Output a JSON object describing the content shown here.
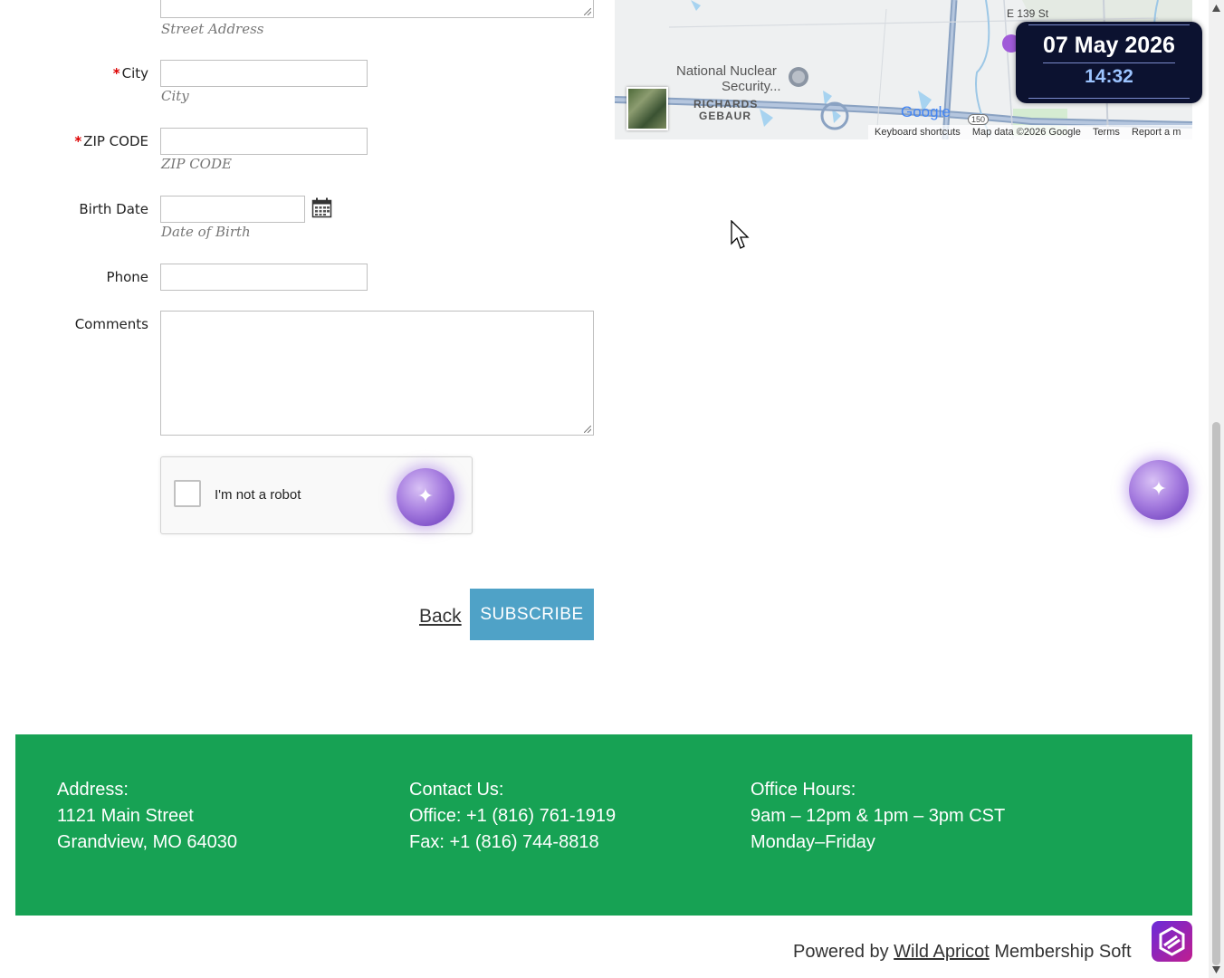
{
  "form": {
    "street_hint": "Street Address",
    "city_label": "City",
    "city_hint": "City",
    "zip_label": "ZIP CODE",
    "zip_hint": "ZIP CODE",
    "birth_label": "Birth Date",
    "birth_hint": "Date of Birth",
    "phone_label": "Phone",
    "comments_label": "Comments",
    "required_mark": "*"
  },
  "captcha": {
    "label": "I'm not a robot"
  },
  "actions": {
    "back_label": "Back",
    "subscribe_label": "SUBSCRIBE"
  },
  "map": {
    "place_1": "National Nuclear",
    "place_1b": "Security...",
    "place_2": "RICHARDS",
    "place_2b": "GEBAUR",
    "street": "E 139 St",
    "route": "150",
    "brand": "Google",
    "keyboard_shortcuts": "Keyboard shortcuts",
    "map_data": "Map data ©2026 Google",
    "terms": "Terms",
    "report": "Report a m"
  },
  "datetime": {
    "date": "07 May 2026",
    "time": "14:32"
  },
  "footer": {
    "address_title": "Address:",
    "address_line1": "1121 Main Street",
    "address_line2": "Grandview, MO 64030",
    "contact_title": "Contact Us:",
    "contact_office": "Office: +1 (816) 761-1919",
    "contact_fax": "Fax: +1 (816) 744-8818",
    "hours_title": "Office Hours:",
    "hours_line1": "9am – 12pm & 1pm – 3pm CST",
    "hours_line2": "Monday–Friday"
  },
  "powered": {
    "prefix": "Powered by ",
    "link": "Wild Apricot",
    "suffix": " Membership Soft"
  },
  "icons": [
    "calendar-icon",
    "sparkle-icon",
    "wild-apricot-logo-icon",
    "mouse-cursor-icon",
    "scroll-up-icon",
    "scroll-down-icon"
  ]
}
